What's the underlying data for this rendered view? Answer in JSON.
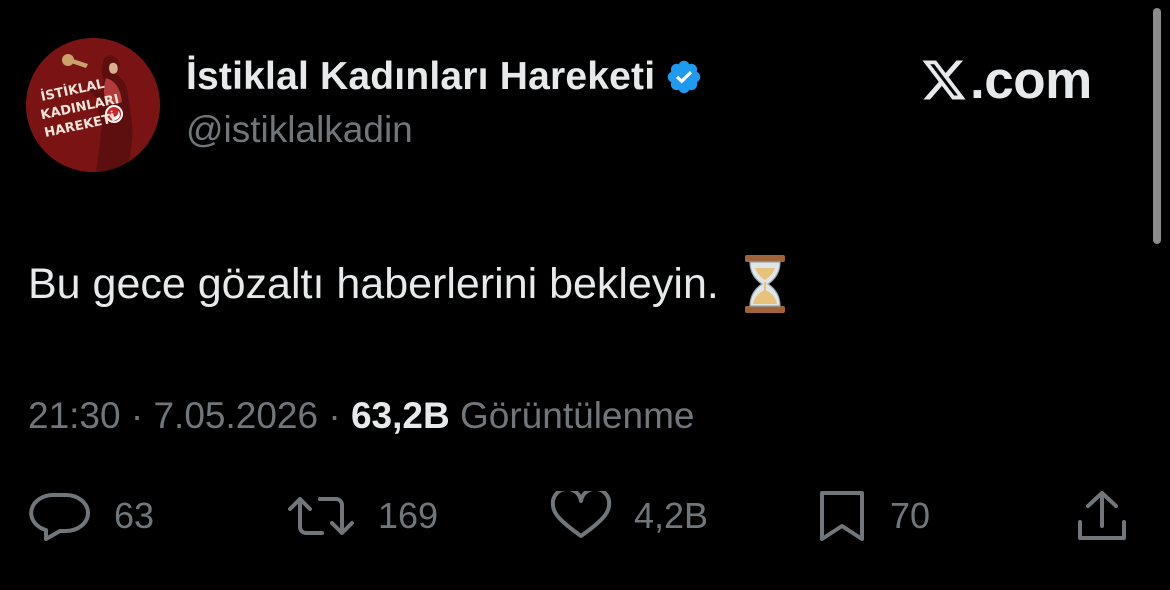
{
  "author": {
    "display_name": "İstiklal Kadınları Hareketi",
    "handle": "@istiklalkadin",
    "verified": true,
    "avatar_logo_lines": [
      "İSTİKLAL",
      "KADINLARI",
      "HAREKETİ"
    ]
  },
  "brand": {
    "site_label": ".com",
    "logo_icon": "x-logo-icon"
  },
  "tweet": {
    "text": "Bu gece gözaltı haberlerini bekleyin.",
    "emoji_icon": "hourglass-icon"
  },
  "meta": {
    "time": "21:30",
    "separator": " · ",
    "date": "7.05.2026",
    "views_count": "63,2B",
    "views_label": "Görüntülenme"
  },
  "actions": {
    "replies": "63",
    "reposts": "169",
    "likes": "4,2B",
    "bookmarks": "70"
  },
  "colors": {
    "background": "#000000",
    "primary_text": "#e7e9ea",
    "secondary_text": "#71767b",
    "verified_blue": "#1d9bf0",
    "avatar_red": "#7a1414"
  }
}
